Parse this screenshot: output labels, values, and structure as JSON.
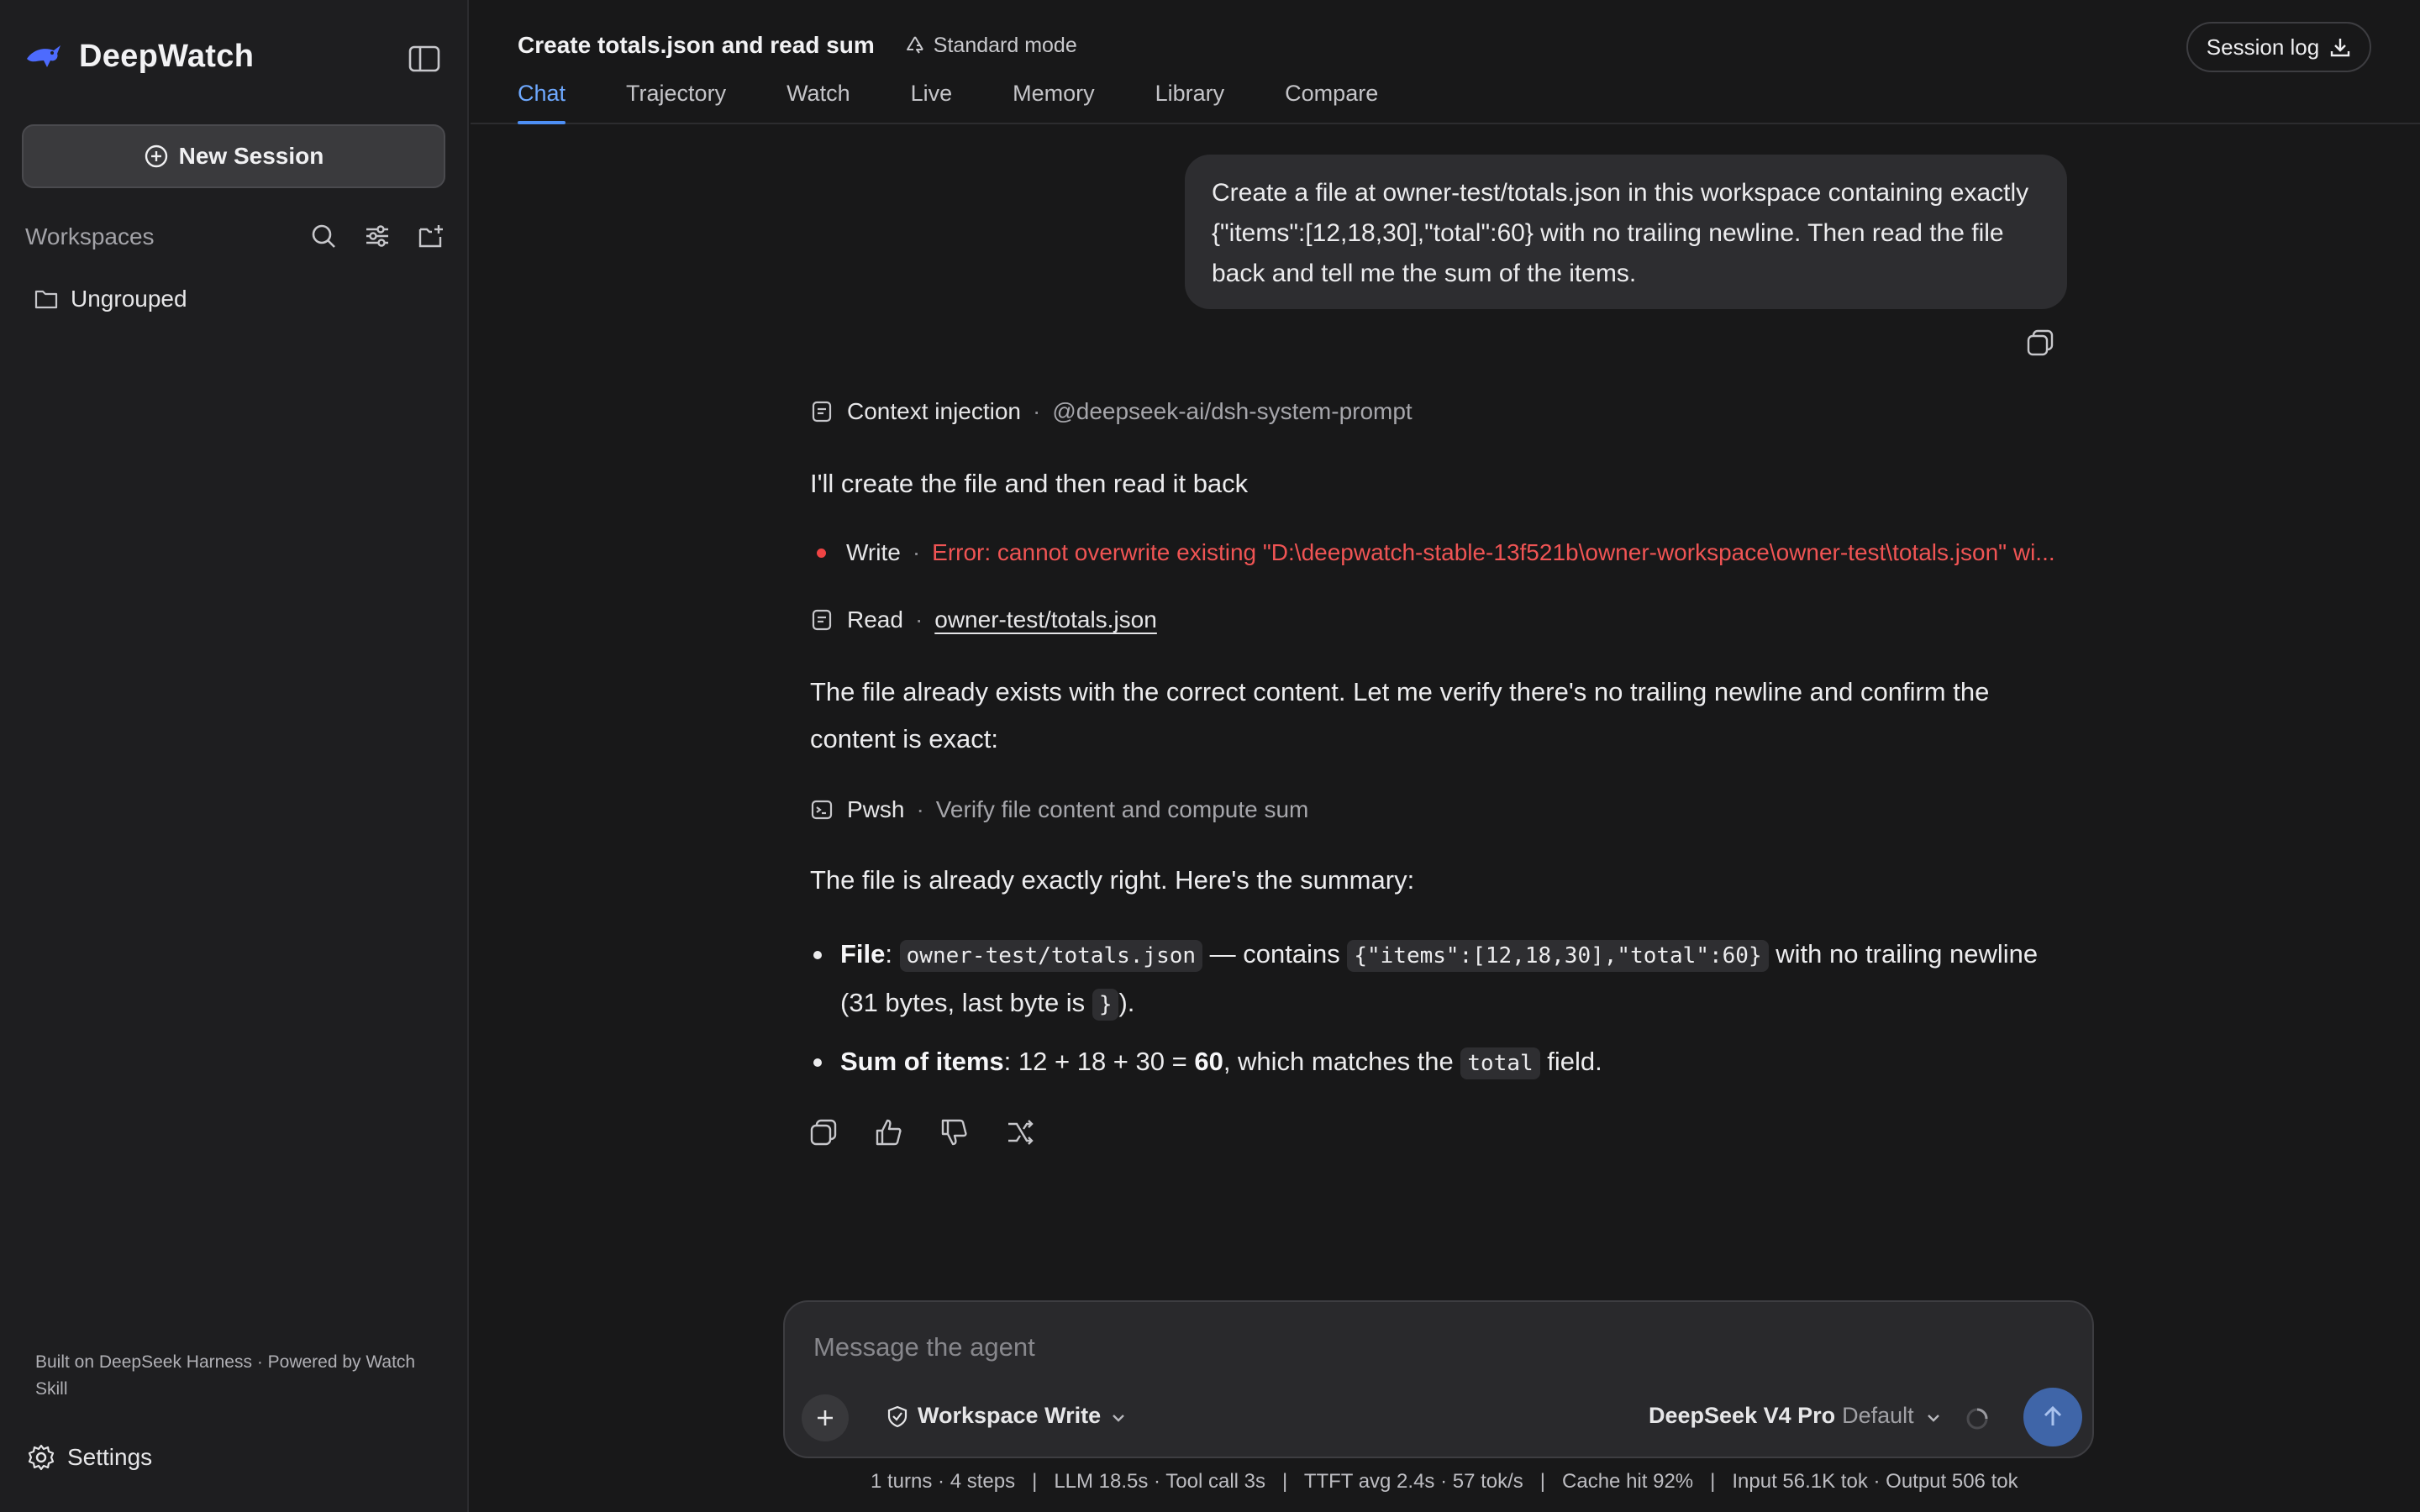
{
  "app": {
    "brand": "DeepWatch",
    "new_session": "New Session",
    "workspaces_title": "Workspaces",
    "groups": [
      "Ungrouped"
    ],
    "footer_note": "Built on DeepSeek Harness · Powered by Watch Skill",
    "settings": "Settings",
    "accent_color": "#4d8ff5",
    "error_color": "#f05454"
  },
  "header": {
    "title": "Create totals.json and read sum",
    "mode": "Standard mode",
    "session_log": "Session log",
    "tabs": [
      "Chat",
      "Trajectory",
      "Watch",
      "Live",
      "Memory",
      "Library",
      "Compare"
    ],
    "active_tab": "Chat"
  },
  "conversation": {
    "user_message": "Create a file at owner-test/totals.json in this workspace containing exactly {\"items\":[12,18,30],\"total\":60} with no trailing newline. Then read the file back and tell me the sum of the items.",
    "context": {
      "name": "Context injection",
      "sep": "·",
      "detail": "@deepseek-ai/dsh-system-prompt"
    },
    "intro": "I'll create the file and then read it back",
    "write_tool": {
      "name": "Write",
      "sep": "·",
      "error": "Error: cannot overwrite existing \"D:\\deepwatch-stable-13f521b\\owner-workspace\\owner-test\\totals.json\" wi..."
    },
    "read_tool": {
      "name": "Read",
      "sep": "·",
      "path": "owner-test/totals.json"
    },
    "verify_text": "The file already exists with the correct content. Let me verify there's no trailing newline and confirm the content is exact:",
    "pwsh_tool": {
      "name": "Pwsh",
      "sep": "·",
      "detail": "Verify file content and compute sum"
    },
    "summary_intro": "The file is already exactly right. Here's the summary:",
    "bullet1": {
      "label": "File",
      "colon": ":",
      "path": "owner-test/totals.json",
      "contains": " — contains ",
      "json": "{\"items\":[12,18,30],\"total\":60}",
      "rest": " with no trailing newline (31 bytes, last byte is ",
      "byte": "}",
      "end": ")."
    },
    "bullet2": {
      "label": "Sum of items",
      "colon": ":",
      "expr": " 12 + 18 + 30 = ",
      "result": "60",
      "rest": ", which matches the ",
      "field": "total",
      "end": " field."
    },
    "action_icons": [
      "copy-icon",
      "thumbs-up-icon",
      "thumbs-down-icon",
      "branch-icon"
    ]
  },
  "composer": {
    "placeholder": "Message the agent",
    "permission": "Workspace Write",
    "model": "DeepSeek V4 Pro",
    "model_tag": "Default"
  },
  "stats": "1 turns · 4 steps   |   LLM 18.5s · Tool call 3s   |   TTFT avg 2.4s · 57 tok/s   |   Cache hit 92%   |   Input 56.1K tok · Output 506 tok"
}
